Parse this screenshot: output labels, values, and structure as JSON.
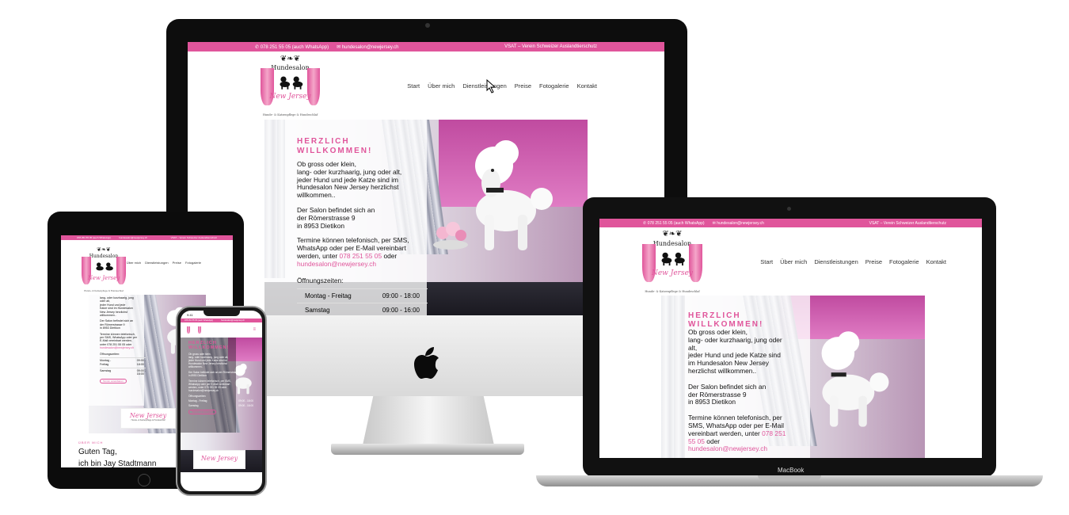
{
  "site": {
    "phone": "078 251 55 05 (auch WhatsApp)",
    "email": "hundesalon@newjersey.ch",
    "vsat": "VSAT – Verein Schweizer Auslandtierschutz",
    "nav": [
      "Start",
      "Über mich",
      "Dienstleistungen",
      "Preise",
      "Fotogalerie",
      "Kontakt"
    ],
    "logo": {
      "crown": "❦❧❦",
      "brand": "Hundesalon",
      "script": "New Jersey",
      "tagline": "Hunde- & Katzenpflege & Hundeschlaf"
    },
    "hero": {
      "title_1": "HERZLICH",
      "title_2": "WILLKOMMEN!",
      "p1_l1": "Ob gross oder klein,",
      "p1_l2": "lang- oder kurzhaarig, jung oder alt,",
      "p1_l3": "jeder Hund und jede Katze sind im",
      "p1_l4": "Hundesalon New Jersey herzlichst",
      "p1_l5": "willkommen..",
      "p2_l1": "Der Salon befindet sich an",
      "p2_l2": "der Römerstrasse 9",
      "p2_l3": "in 8953 Dietikon",
      "p3_l1": "Termine können telefonisch, per SMS,",
      "p3_l2": "WhatsApp oder per E-Mail vereinbart",
      "p3_l3": "werden, unter",
      "p3_phone": "078 251 55 05",
      "p3_oder": "oder",
      "p3_email": "hundesalon@newjersey.ch",
      "hours_title": "Öffnungszeiten:",
      "row1_day": "Montag - Freitag",
      "row1_time": "09:00 - 18:00",
      "row2_day": "Samstag",
      "row2_time": "09:00 - 16:00"
    },
    "mb_hero": {
      "p1_l1": "Ob gross oder klein,",
      "p1_l2": "lang- oder kurzhaarig, jung oder",
      "p1_l3": "alt,",
      "p1_l4": "jeder Hund und jede Katze sind",
      "p1_l5": "im Hundesalon New Jersey",
      "p1_l6": "herzlichst willkommen..",
      "p3_l1": "Termine können telefonisch, per",
      "p3_l2": "SMS, WhatsApp oder per E-Mail",
      "p3_l3": "vereinbart werden, unter",
      "p3_phone_a": "078 251",
      "p3_phone_b": "55 05",
      "p3_oder": "oder"
    },
    "ipad": {
      "snippet_1": "lang- oder kurzhaarig, jung",
      "snippet_2": "oder alt,",
      "snippet_3": "jeder Hund und jede",
      "snippet_4": "Katze sind im Hundesalon",
      "snippet_5": "New Jersey herzlichst",
      "snippet_6": "willkommen..",
      "salon_1": "Der Salon befindet sich an",
      "salon_2": "der Römerstrasse 9",
      "salon_3": "in 8953 Dietikon",
      "termine_1": "Termine können telefonisch,",
      "termine_2": "per SMS, WhatsApp oder per",
      "termine_3": "E-Mail vereinbart werden,",
      "termine_4": "unter 078 251 55 05 oder",
      "termine_5": "hundesalon@newjersey.ch",
      "hours": "Öffnungszeiten:",
      "r1_day_a": "Montag -",
      "r1_day_b": "Freitag",
      "r1_time_a": "09:00 -",
      "r1_time_b": "18:00",
      "r2_day": "Samstag",
      "r2_time_a": "09:00 -",
      "r2_time_b": "16:00",
      "button": "Termin vereinbaren",
      "kicker": "ÜBER MICH",
      "greeting": "Guten Tag,",
      "intro": "ich bin Jay Stadtmann"
    },
    "iphone": {
      "time": "9:41",
      "title_1": "HERZLICH",
      "title_2": "WILLKOMMEN!",
      "l1": "Ob gross oder klein,",
      "l2": "lang- oder kurzhaarig, jung oder alt,",
      "l3": "jeder Hund und jede Katze sind im",
      "l4": "Hundesalon New Jersey herzlichst",
      "l5": "willkommen..",
      "salon": "Der Salon befindet sich an der Römerstrasse 9",
      "salon_2": "in 8953 Dietikon",
      "t1": "Termine können telefonisch, per SMS,",
      "t2": "WhatsApp oder per E-Mail vereinbart",
      "t3": "werden, unter 078 251 55 05 oder",
      "t4": "hundesalon@newjersey.ch",
      "hours": "Öffnungszeiten:",
      "r1_day": "Montag - Freitag",
      "r1_time": "09:00 - 18:00",
      "r2_day": "Samstag",
      "r2_time": "09:00 - 16:00",
      "button": "Termin vereinbaren",
      "sign": "New Jersey"
    },
    "macbook_label": "MacBook"
  },
  "colors": {
    "accent": "#e0559b",
    "dark": "#111111"
  }
}
